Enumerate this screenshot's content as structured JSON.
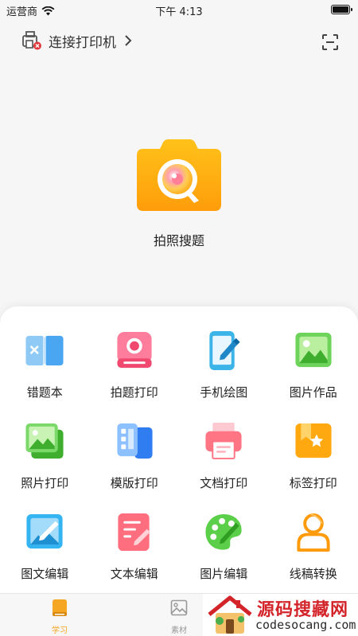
{
  "status_bar": {
    "carrier": "运营商",
    "time": "下午 4:13"
  },
  "top_bar": {
    "printer_label": "连接打印机"
  },
  "hero": {
    "label": "拍照搜题"
  },
  "features": [
    {
      "label": "错题本",
      "icon": "wrong-book-icon"
    },
    {
      "label": "拍题打印",
      "icon": "photo-print-question-icon"
    },
    {
      "label": "手机绘图",
      "icon": "phone-draw-icon"
    },
    {
      "label": "图片作品",
      "icon": "picture-works-icon"
    },
    {
      "label": "照片打印",
      "icon": "photo-print-icon"
    },
    {
      "label": "模版打印",
      "icon": "template-print-icon"
    },
    {
      "label": "文档打印",
      "icon": "document-print-icon"
    },
    {
      "label": "标签打印",
      "icon": "label-print-icon"
    },
    {
      "label": "图文编辑",
      "icon": "image-text-edit-icon"
    },
    {
      "label": "文本编辑",
      "icon": "text-edit-icon"
    },
    {
      "label": "图片编辑",
      "icon": "image-edit-icon"
    },
    {
      "label": "线稿转换",
      "icon": "line-art-convert-icon"
    }
  ],
  "tabs": [
    {
      "label": "学习",
      "active": true
    },
    {
      "label": "素材",
      "active": false
    }
  ],
  "watermark": {
    "title": "源码搜藏网",
    "url": "codesocang.com"
  },
  "colors": {
    "accent": "#f5a623",
    "tab_inactive": "#999999",
    "watermark_red": "#d3242a"
  }
}
